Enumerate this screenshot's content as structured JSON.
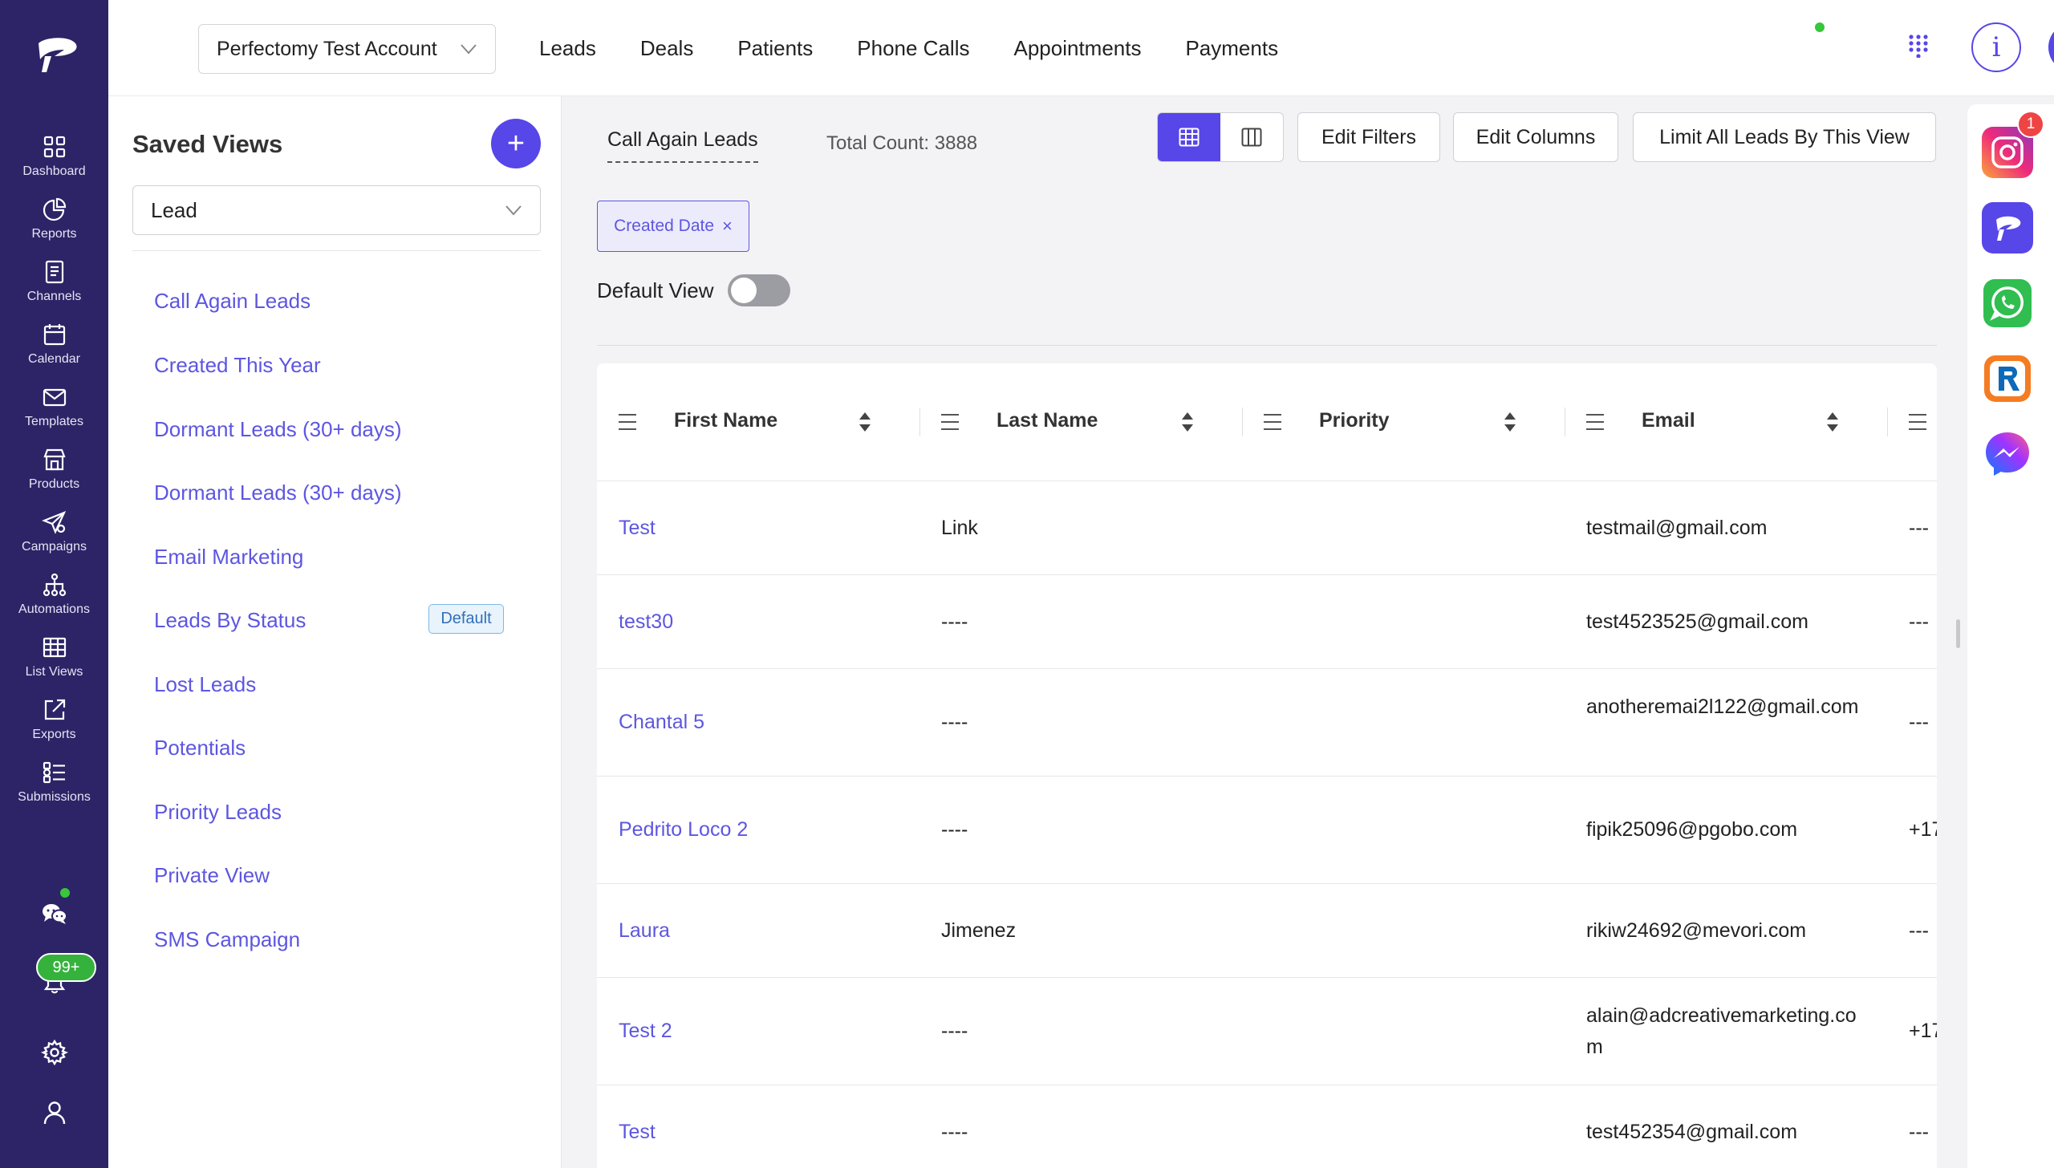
{
  "leftnav": {
    "items": [
      {
        "label": "Dashboard",
        "icon": "dashboard-icon"
      },
      {
        "label": "Reports",
        "icon": "reports-icon"
      },
      {
        "label": "Channels",
        "icon": "channels-icon"
      },
      {
        "label": "Calendar",
        "icon": "calendar-icon"
      },
      {
        "label": "Templates",
        "icon": "templates-icon"
      },
      {
        "label": "Products",
        "icon": "products-icon"
      },
      {
        "label": "Campaigns",
        "icon": "campaigns-icon"
      },
      {
        "label": "Automations",
        "icon": "automations-icon"
      },
      {
        "label": "List Views",
        "icon": "list-views-icon"
      },
      {
        "label": "Exports",
        "icon": "exports-icon"
      },
      {
        "label": "Submissions",
        "icon": "submissions-icon"
      }
    ],
    "notifications_badge": "99+"
  },
  "topbar": {
    "account": "Perfectomy Test Account",
    "nav": [
      "Leads",
      "Deals",
      "Patients",
      "Phone Calls",
      "Appointments",
      "Payments"
    ],
    "info_label": "i"
  },
  "saved_views": {
    "title": "Saved Views",
    "add_label": "+",
    "type_select": "Lead",
    "items": [
      "Call Again Leads",
      "Created This Year",
      "Dormant Leads (30+ days)",
      "Dormant Leads (30+ days)",
      "Email Marketing",
      "Leads By Status",
      "Lost Leads",
      "Potentials",
      "Priority Leads",
      "Private View",
      "SMS Campaign"
    ],
    "default_badge": "Default"
  },
  "main": {
    "active_view": "Call Again Leads",
    "total_count": "Total Count: 3888",
    "edit_filters": "Edit Filters",
    "edit_columns": "Edit Columns",
    "limit_button": "Limit All Leads By This View",
    "filter_chip": "Created Date",
    "chip_close": "×",
    "default_view_label": "Default View",
    "default_view_on": false
  },
  "table": {
    "columns": [
      "First Name",
      "Last Name",
      "Priority",
      "Email"
    ],
    "rows": [
      {
        "first": "Test",
        "last": "Link",
        "priority": "",
        "email": "testmail@gmail.com",
        "extra": "---"
      },
      {
        "first": "test30",
        "last": "----",
        "priority": "",
        "email": "test4523525@gmail.com",
        "extra": "---"
      },
      {
        "first": "Chantal 5",
        "last": "----",
        "priority": "",
        "email": "anotheremai2l122@gmail.com",
        "extra": "---"
      },
      {
        "first": "Pedrito Loco 2",
        "last": "----",
        "priority": "",
        "email": "fipik25096@pgobo.com",
        "extra": "+17"
      },
      {
        "first": "Laura",
        "last": "Jimenez",
        "priority": "",
        "email": "rikiw24692@mevori.com",
        "extra": "---"
      },
      {
        "first": "Test 2",
        "last": "----",
        "priority": "",
        "email": "alain@adcreativemarketing.com",
        "extra": "+17"
      },
      {
        "first": "Test",
        "last": "----",
        "priority": "",
        "email": "test452354@gmail.com",
        "extra": "---"
      }
    ]
  },
  "apps": {
    "items": [
      "instagram-icon",
      "perfectomy-phone-icon",
      "whatsapp-icon",
      "ringcentral-icon",
      "messenger-icon"
    ],
    "instagram_badge": "1"
  },
  "colors": {
    "nav_bg": "#2c2466",
    "accent": "#5746e8",
    "link": "#5d56e0"
  }
}
